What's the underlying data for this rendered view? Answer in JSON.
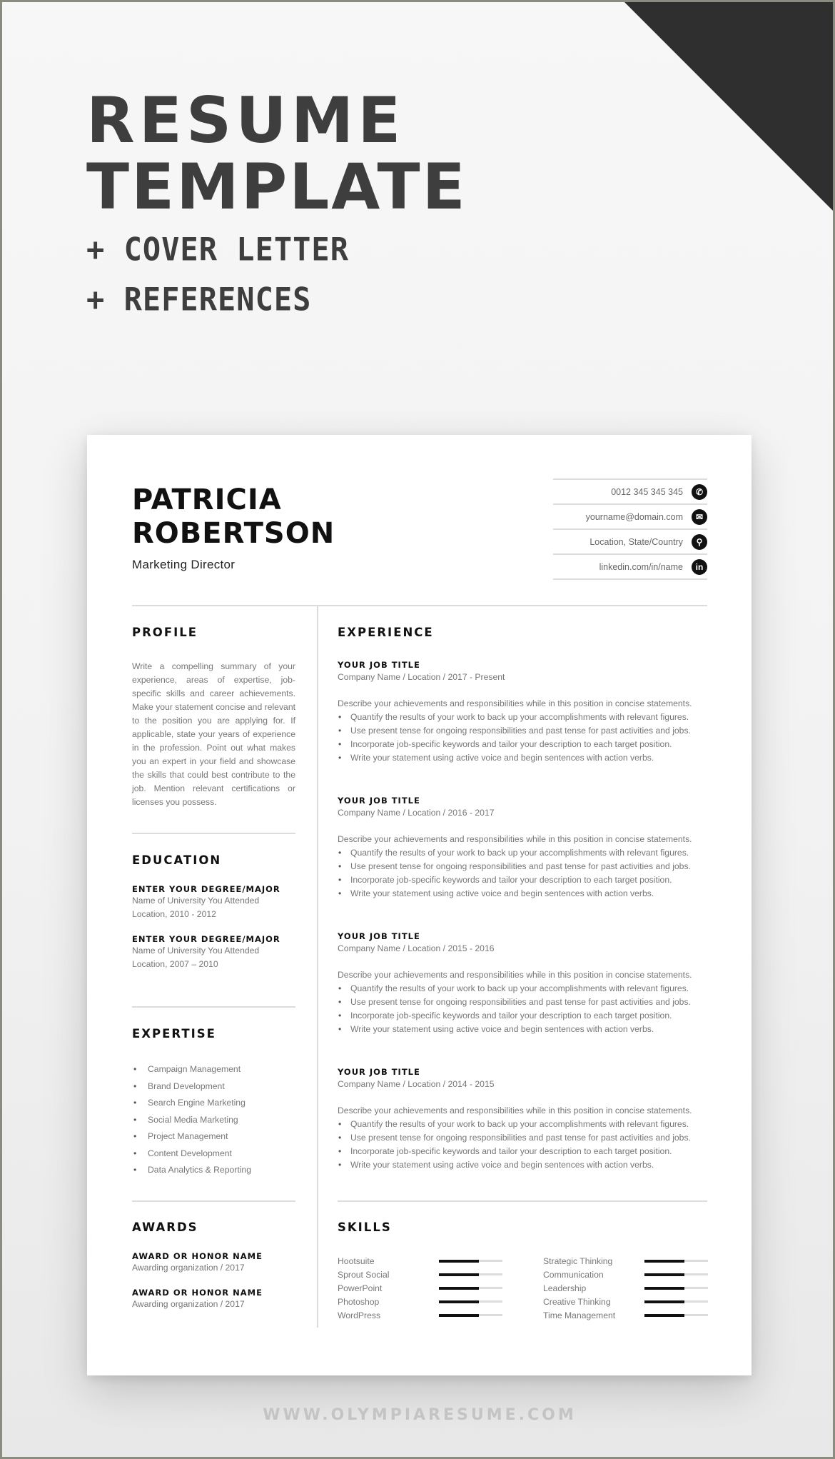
{
  "hero": {
    "title_line1": "RESUME",
    "title_line2": "TEMPLATE",
    "sub_line1": "+ COVER LETTER",
    "sub_line2": "+ REFERENCES"
  },
  "resume": {
    "name_line1": "PATRICIA",
    "name_line2": "ROBERTSON",
    "role": "Marketing Director",
    "contact": [
      {
        "text": "0012 345 345 345",
        "icon": "phone-icon",
        "glyph": "✆"
      },
      {
        "text": "yourname@domain.com",
        "icon": "email-icon",
        "glyph": "✉"
      },
      {
        "text": "Location, State/Country",
        "icon": "location-pin-icon",
        "glyph": "⚲"
      },
      {
        "text": "linkedin.com/in/name",
        "icon": "linkedin-icon",
        "glyph": "in"
      }
    ],
    "profile": {
      "heading": "PROFILE",
      "text": "Write a compelling summary of your experience, areas of expertise, job-specific skills and career achievements. Make your statement concise and relevant to the position you are applying for. If applicable, state your years of experience in the profession. Point out what makes you an expert in your field and showcase the skills that could best contribute to the job. Mention relevant certifications or licenses you possess."
    },
    "education": {
      "heading": "EDUCATION",
      "items": [
        {
          "degree": "ENTER YOUR DEGREE/MAJOR",
          "school": "Name of University You Attended",
          "details": "Location, 2010 - 2012"
        },
        {
          "degree": "ENTER YOUR DEGREE/MAJOR",
          "school": "Name of University You Attended",
          "details": "Location, 2007 – 2010"
        }
      ]
    },
    "expertise": {
      "heading": "EXPERTISE",
      "items": [
        "Campaign Management",
        "Brand Development",
        "Search Engine Marketing",
        "Social Media Marketing",
        "Project Management",
        "Content Development",
        "Data Analytics & Reporting"
      ]
    },
    "awards": {
      "heading": "AWARDS",
      "items": [
        {
          "name": "AWARD OR HONOR NAME",
          "org": "Awarding organization / 2017"
        },
        {
          "name": "AWARD OR HONOR NAME",
          "org": "Awarding organization / 2017"
        }
      ]
    },
    "experience": {
      "heading": "EXPERIENCE",
      "jobs": [
        {
          "title": "YOUR JOB TITLE",
          "meta": "Company Name / Location / 2017 - Present",
          "description": "Describe your achievements and responsibilities while in this position in concise statements.",
          "bullets": [
            "Quantify the results of your work to back up your accomplishments with relevant figures.",
            "Use present tense for ongoing responsibilities and past tense for past activities and jobs.",
            "Incorporate job-specific keywords and tailor your description to each target position.",
            "Write your statement using active voice and begin sentences with action verbs."
          ]
        },
        {
          "title": "YOUR JOB TITLE",
          "meta": "Company Name / Location / 2016 - 2017",
          "description": "Describe your achievements and responsibilities while in this position in concise statements.",
          "bullets": [
            "Quantify the results of your work to back up your accomplishments with relevant figures.",
            "Use present tense for ongoing responsibilities and past tense for past activities and jobs.",
            "Incorporate job-specific keywords and tailor your description to each target position.",
            "Write your statement using active voice and begin sentences with action verbs."
          ]
        },
        {
          "title": "YOUR JOB TITLE",
          "meta": "Company Name / Location / 2015 - 2016",
          "description": "Describe your achievements and responsibilities while in this position in concise statements.",
          "bullets": [
            "Quantify the results of your work to back up your accomplishments with relevant figures.",
            "Use present tense for ongoing responsibilities and past tense for past activities and jobs.",
            "Incorporate job-specific keywords and tailor your description to each target position.",
            "Write your statement using active voice and begin sentences with action verbs."
          ]
        },
        {
          "title": "YOUR JOB TITLE",
          "meta": "Company Name / Location / 2014 - 2015",
          "description": "Describe your achievements and responsibilities while in this position in concise statements.",
          "bullets": [
            "Quantify the results of your work to back up your accomplishments with relevant figures.",
            "Use present tense for ongoing responsibilities and past tense for past activities and jobs.",
            "Incorporate job-specific keywords and tailor your description to each target position.",
            "Write your statement using active voice and begin sentences with action verbs."
          ]
        }
      ]
    },
    "skills": {
      "heading": "SKILLS",
      "items": [
        {
          "name": "Hootsuite",
          "level": 0.63
        },
        {
          "name": "Strategic Thinking",
          "level": 0.63
        },
        {
          "name": "Sprout Social",
          "level": 0.63
        },
        {
          "name": "Communication",
          "level": 0.63
        },
        {
          "name": "PowerPoint",
          "level": 0.63
        },
        {
          "name": "Leadership",
          "level": 0.63
        },
        {
          "name": "Photoshop",
          "level": 0.63
        },
        {
          "name": "Creative Thinking",
          "level": 0.63
        },
        {
          "name": "WordPress",
          "level": 0.63
        },
        {
          "name": "Time Management",
          "level": 0.63
        }
      ]
    }
  },
  "footer": {
    "url": "WWW.OLYMPIARESUME.COM"
  },
  "colors": {
    "accent_dark": "#2f2f2f",
    "hero_text": "#3e3e3e",
    "rule": "#dcdcdc"
  }
}
